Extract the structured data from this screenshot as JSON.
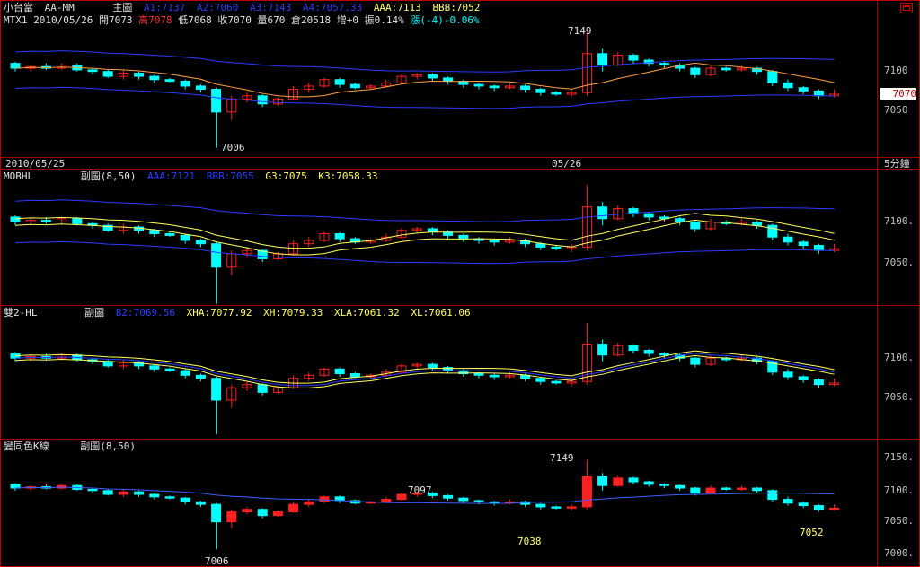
{
  "top": {
    "title": "小台當",
    "symbol": "AA-MM",
    "main_label": "主圖",
    "a1": "A1:7137",
    "a2": "A2:7060",
    "a3": "A3:7143",
    "a4": "A4:7057.33",
    "aaa": "AAA:7113",
    "bbb": "BBB:7052",
    "arrow_down": "↓",
    "instrument": "MTX1",
    "date": "2010/05/26",
    "open": "開7073",
    "high": "高7078",
    "low": "低7068",
    "close": "收7070",
    "vol": "量670",
    "oi": "倉20518",
    "inc": "增+0",
    "amp": "振0.14%",
    "chg": "漲(-4)-0.06%",
    "annotation_high": "7149",
    "annotation_low": "7006",
    "axis_7100": "7100",
    "axis_7050": "7050",
    "price_tag": "7070",
    "date_left": "2010/05/25",
    "date_mid": "05/26",
    "interval": "5分鐘"
  },
  "p2": {
    "title": "MOBHL",
    "sub": "副圖(8,50)",
    "aaa": "AAA:7121",
    "bbb": "BBB:7055",
    "g3": "G3:7075",
    "k3": "K3:7058.33",
    "axis_7100": "7100.",
    "axis_7050": "7050."
  },
  "p3": {
    "title": "雙2-HL",
    "sub": "副圖",
    "b2": "B2:7069.56",
    "xha": "XHA:7077.92",
    "xh": "XH:7079.33",
    "xla": "XLA:7061.32",
    "xl": "XL:7061.06",
    "axis_7100": "7100.",
    "axis_7050": "7050."
  },
  "p4": {
    "title": "變同色K線",
    "sub": "副圖(8,50)",
    "ann_7097": "7097",
    "ann_7149": "7149",
    "ann_7038": "7038",
    "ann_7052": "7052",
    "ann_7006": "7006",
    "axis_7150": "7150.",
    "axis_7100": "7100.",
    "axis_7050": "7050.",
    "axis_7000": "7000."
  },
  "colors": {
    "up": "#ff2020",
    "down": "#00ffff",
    "blue": "#2a3cff",
    "yellow": "#ffff60",
    "orange": "#ffa040"
  },
  "candles": [
    [
      7110,
      7104,
      7112,
      7100
    ],
    [
      7104,
      7106,
      7108,
      7100
    ],
    [
      7106,
      7104,
      7110,
      7102
    ],
    [
      7104,
      7108,
      7110,
      7102
    ],
    [
      7108,
      7102,
      7110,
      7100
    ],
    [
      7102,
      7100,
      7104,
      7096
    ],
    [
      7100,
      7094,
      7102,
      7092
    ],
    [
      7094,
      7098,
      7102,
      7090
    ],
    [
      7098,
      7094,
      7100,
      7090
    ],
    [
      7094,
      7090,
      7096,
      7086
    ],
    [
      7090,
      7088,
      7092,
      7086
    ],
    [
      7088,
      7082,
      7090,
      7078
    ],
    [
      7082,
      7078,
      7084,
      7074
    ],
    [
      7078,
      7050,
      7080,
      7006
    ],
    [
      7050,
      7066,
      7070,
      7040
    ],
    [
      7066,
      7070,
      7074,
      7062
    ],
    [
      7070,
      7060,
      7072,
      7056
    ],
    [
      7060,
      7066,
      7068,
      7058
    ],
    [
      7066,
      7078,
      7082,
      7064
    ],
    [
      7078,
      7082,
      7086,
      7074
    ],
    [
      7082,
      7090,
      7092,
      7080
    ],
    [
      7090,
      7084,
      7092,
      7080
    ],
    [
      7084,
      7080,
      7086,
      7078
    ],
    [
      7080,
      7082,
      7084,
      7078
    ],
    [
      7082,
      7086,
      7090,
      7080
    ],
    [
      7086,
      7094,
      7097,
      7084
    ],
    [
      7094,
      7096,
      7098,
      7090
    ],
    [
      7096,
      7092,
      7098,
      7088
    ],
    [
      7092,
      7088,
      7094,
      7084
    ],
    [
      7088,
      7084,
      7090,
      7080
    ],
    [
      7084,
      7082,
      7086,
      7078
    ],
    [
      7082,
      7080,
      7084,
      7076
    ],
    [
      7080,
      7082,
      7086,
      7078
    ],
    [
      7082,
      7078,
      7084,
      7074
    ],
    [
      7078,
      7074,
      7080,
      7070
    ],
    [
      7074,
      7072,
      7076,
      7070
    ],
    [
      7072,
      7074,
      7078,
      7068
    ],
    [
      7074,
      7122,
      7149,
      7070
    ],
    [
      7122,
      7108,
      7128,
      7100
    ],
    [
      7108,
      7120,
      7124,
      7106
    ],
    [
      7120,
      7114,
      7122,
      7110
    ],
    [
      7114,
      7110,
      7116,
      7106
    ],
    [
      7110,
      7108,
      7112,
      7104
    ],
    [
      7108,
      7104,
      7110,
      7100
    ],
    [
      7104,
      7096,
      7106,
      7092
    ],
    [
      7096,
      7104,
      7108,
      7094
    ],
    [
      7104,
      7102,
      7106,
      7100
    ],
    [
      7102,
      7104,
      7108,
      7100
    ],
    [
      7104,
      7100,
      7106,
      7096
    ],
    [
      7100,
      7086,
      7102,
      7082
    ],
    [
      7086,
      7080,
      7090,
      7076
    ],
    [
      7080,
      7076,
      7082,
      7072
    ],
    [
      7076,
      7070,
      7078,
      7066
    ],
    [
      7070,
      7072,
      7078,
      7068
    ]
  ]
}
